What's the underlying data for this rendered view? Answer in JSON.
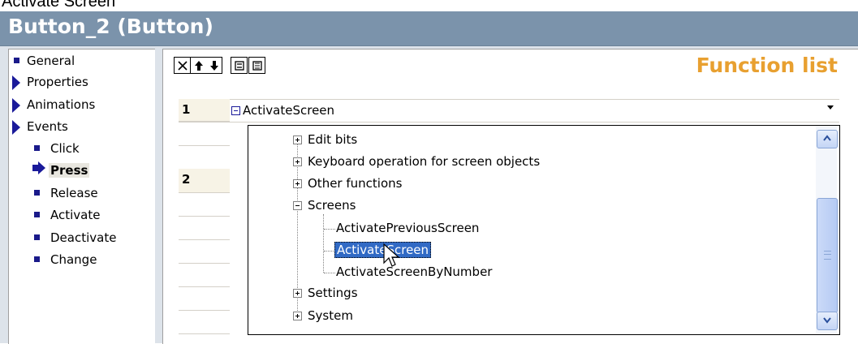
{
  "caption": "Activate Screen\"",
  "window": {
    "title": "Button_2 (Button)"
  },
  "nav": {
    "items": [
      {
        "label": "General",
        "marker": "square"
      },
      {
        "label": "Properties",
        "marker": "triangle"
      },
      {
        "label": "Animations",
        "marker": "triangle"
      },
      {
        "label": "Events",
        "marker": "triangle"
      }
    ],
    "events": [
      {
        "label": "Click"
      },
      {
        "label": "Press",
        "selected": true
      },
      {
        "label": "Release"
      },
      {
        "label": "Activate"
      },
      {
        "label": "Deactivate"
      },
      {
        "label": "Change"
      }
    ]
  },
  "toolbar": {
    "icons": [
      "delete-icon",
      "move-up-icon",
      "move-down-icon",
      "collapse-icon",
      "expand-icon"
    ]
  },
  "function_list": {
    "title": "Function list",
    "rows": [
      {
        "number": "1",
        "function": "ActivateScreen"
      },
      {
        "number": "2",
        "function": ""
      }
    ]
  },
  "dropdown": {
    "tree": [
      {
        "label": "Edit bits",
        "expander": "+"
      },
      {
        "label": "Keyboard operation for screen objects",
        "expander": "+"
      },
      {
        "label": "Other functions",
        "expander": "+"
      },
      {
        "label": "Screens",
        "expander": "-"
      },
      {
        "label": "ActivatePreviousScreen",
        "child": true
      },
      {
        "label": "ActivateScreen",
        "child": true,
        "selected": true
      },
      {
        "label": "ActivateScreenByNumber",
        "child": true
      },
      {
        "label": "Settings",
        "expander": "+"
      },
      {
        "label": "System",
        "expander": "+"
      }
    ]
  },
  "colors": {
    "title_bar": "#7b93ab",
    "accent_title": "#e8a030",
    "selection": "#316ac5",
    "nav_marker": "#1a1a9a"
  }
}
